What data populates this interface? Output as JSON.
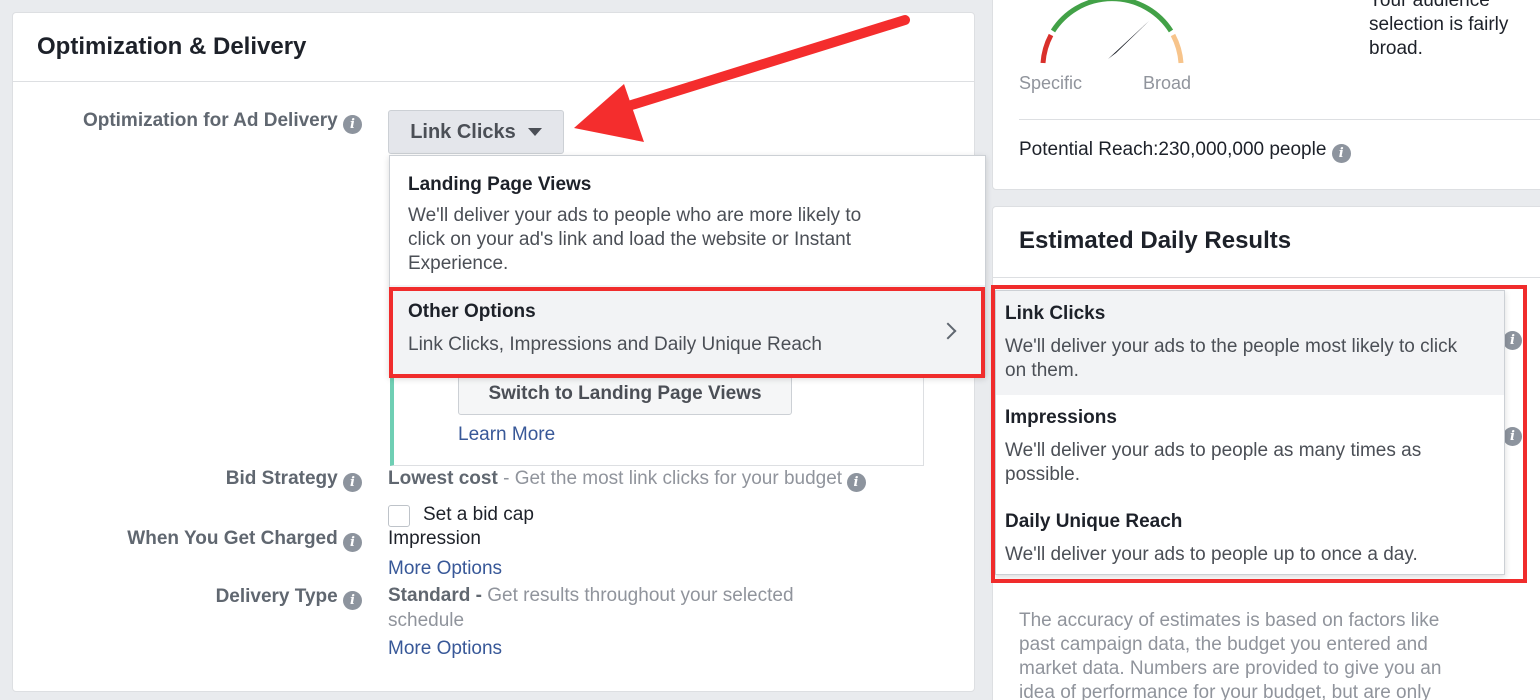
{
  "left_card": {
    "title": "Optimization & Delivery",
    "optimization_label": "Optimization for Ad Delivery",
    "optimization_value": "Link Clicks",
    "dropdown": {
      "first_option": {
        "title": "Landing Page Views",
        "description_lines": [
          "We'll deliver your ads to people who are more likely to",
          "click on your ad's link and load the website or Instant",
          "Experience."
        ]
      },
      "other_options": {
        "title": "Other Options",
        "description": "Link Clicks, Impressions and Daily Unique Reach"
      }
    },
    "switch_button": "Switch to Landing Page Views",
    "learn_more": "Learn More",
    "bid_strategy": {
      "label": "Bid Strategy",
      "value_bold": "Lowest cost",
      "value_rest": " - Get the most link clicks for your budget",
      "bid_cap_label": "Set a bid cap"
    },
    "when_charged": {
      "label": "When You Get Charged",
      "value": "Impression",
      "more_options": "More Options"
    },
    "delivery_type": {
      "label": "Delivery Type",
      "value_bold": "Standard -",
      "value_rest_line1": " Get results throughout your selected",
      "value_rest_line2": "schedule",
      "more_options": "More Options"
    }
  },
  "audience_card": {
    "gauge_specific": "Specific",
    "gauge_broad": "Broad",
    "summary_lines": [
      "Your audience",
      "selection is fairly",
      "broad."
    ],
    "potential_reach": "Potential Reach:230,000,000 people",
    "gauge_level": "broad",
    "gauge_colors": {
      "low": "#d9302b",
      "mid": "#42a147",
      "high": "#f7c48b"
    }
  },
  "results_card": {
    "title": "Estimated Daily Results",
    "footnote_lines": [
      "The accuracy of estimates is based on factors like",
      "past campaign data, the budget you entered and",
      "market data. Numbers are provided to give you an",
      "idea of performance for your budget, but are only"
    ]
  },
  "sub_menu": {
    "items": [
      {
        "title": "Link Clicks",
        "description_lines": [
          "We'll deliver your ads to the people most likely to click",
          "on them."
        ]
      },
      {
        "title": "Impressions",
        "description_lines": [
          "We'll deliver your ads to people as many times as",
          "possible."
        ]
      },
      {
        "title": "Daily Unique Reach",
        "description_lines": [
          "We'll deliver your ads to people up to once a day."
        ]
      }
    ]
  },
  "annotation_colors": {
    "highlight": "#f02c2c",
    "arrow": "#f42d2d"
  }
}
